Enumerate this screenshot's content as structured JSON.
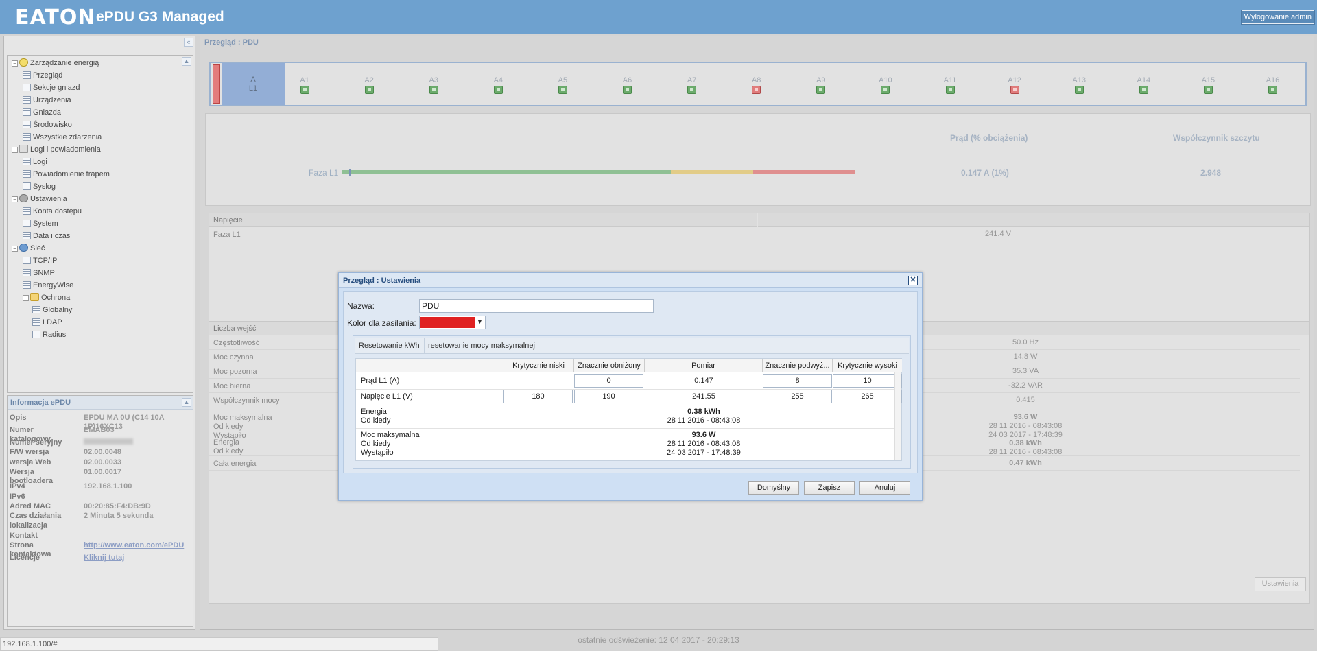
{
  "header": {
    "logo": "EATON",
    "title": "ePDU G3 Managed",
    "logout_label": "Wylogowanie admin"
  },
  "tree": {
    "items": [
      {
        "label": "Zarządzanie energią",
        "level": 0,
        "icon": "bulb-icon"
      },
      {
        "label": "Przegląd",
        "level": 1,
        "icon": "page-icon"
      },
      {
        "label": "Sekcje gniazd",
        "level": 1,
        "icon": "page-icon"
      },
      {
        "label": "Urządzenia",
        "level": 1,
        "icon": "page-icon"
      },
      {
        "label": "Gniazda",
        "level": 1,
        "icon": "page-icon"
      },
      {
        "label": "Środowisko",
        "level": 1,
        "icon": "page-icon"
      },
      {
        "label": "Wszystkie zdarzenia",
        "level": 1,
        "icon": "page-icon"
      },
      {
        "label": "Logi i powiadomienia",
        "level": 0,
        "icon": "log-icon"
      },
      {
        "label": "Logi",
        "level": 1,
        "icon": "page-icon"
      },
      {
        "label": "Powiadomienie trapem",
        "level": 1,
        "icon": "page-icon"
      },
      {
        "label": "Syslog",
        "level": 1,
        "icon": "page-icon"
      },
      {
        "label": "Ustawienia",
        "level": 0,
        "icon": "gear-icon"
      },
      {
        "label": "Konta dostępu",
        "level": 1,
        "icon": "page-icon"
      },
      {
        "label": "System",
        "level": 1,
        "icon": "page-icon"
      },
      {
        "label": "Data i czas",
        "level": 1,
        "icon": "page-icon"
      },
      {
        "label": "Sieć",
        "level": 0,
        "icon": "globe-icon"
      },
      {
        "label": "TCP/IP",
        "level": 1,
        "icon": "page-icon"
      },
      {
        "label": "SNMP",
        "level": 1,
        "icon": "page-icon"
      },
      {
        "label": "EnergyWise",
        "level": 1,
        "icon": "page-icon"
      },
      {
        "label": "Ochrona",
        "level": 1,
        "icon": "folder-icon"
      },
      {
        "label": "Globalny",
        "level": 2,
        "icon": "page-icon"
      },
      {
        "label": "LDAP",
        "level": 2,
        "icon": "page-icon"
      },
      {
        "label": "Radius",
        "level": 2,
        "icon": "page-icon"
      }
    ]
  },
  "info": {
    "title": "Informacja ePDU",
    "rows": [
      {
        "label": "Opis",
        "value": "EPDU MA 0U (C14 10A 1P)16XC13"
      },
      {
        "label": "Numer katalogowy",
        "value": "EMAB03"
      },
      {
        "label": "Numer seryjny",
        "value": ""
      },
      {
        "label": "F/W wersja",
        "value": "02.00.0048"
      },
      {
        "label": "wersja Web",
        "value": "02.00.0033"
      },
      {
        "label": "Wersja bootloadera",
        "value": "01.00.0017"
      },
      {
        "label": "IPv4",
        "value": "192.168.1.100"
      },
      {
        "label": "IPv6",
        "value": ""
      },
      {
        "label": "Adred MAC",
        "value": "00:20:85:F4:DB:9D"
      },
      {
        "label": "Czas działania",
        "value": "2 Minuta 5 sekunda"
      },
      {
        "label": "lokalizacja",
        "value": ""
      },
      {
        "label": "Kontakt",
        "value": ""
      },
      {
        "label": "Strona kontaktowa",
        "value": "http://www.eaton.com/ePDU"
      },
      {
        "label": "Licencje",
        "value": "Kliknij tutaj"
      }
    ]
  },
  "main": {
    "breadcrumb": "Przegląd : PDU",
    "group_a": {
      "name": "A",
      "phase": "L1"
    },
    "outlets": [
      {
        "label": "A1",
        "state": "on"
      },
      {
        "label": "A2",
        "state": "on"
      },
      {
        "label": "A3",
        "state": "on"
      },
      {
        "label": "A4",
        "state": "on"
      },
      {
        "label": "A5",
        "state": "on"
      },
      {
        "label": "A6",
        "state": "on"
      },
      {
        "label": "A7",
        "state": "on"
      },
      {
        "label": "A8",
        "state": "off"
      },
      {
        "label": "A9",
        "state": "on"
      },
      {
        "label": "A10",
        "state": "on"
      },
      {
        "label": "A11",
        "state": "on"
      },
      {
        "label": "A12",
        "state": "off"
      },
      {
        "label": "A13",
        "state": "on"
      },
      {
        "label": "A14",
        "state": "on"
      },
      {
        "label": "A15",
        "state": "on"
      },
      {
        "label": "A16",
        "state": "on"
      }
    ],
    "load": {
      "current_header": "Prąd (% obciążenia)",
      "crest_header": "Współczynnik szczytu",
      "phase_label": "Faza L1",
      "current_value": "0.147 A (1%)",
      "crest_value": "2.948",
      "load_percent": 1
    },
    "voltage": {
      "header": "Napięcie",
      "phase_label": "Faza L1",
      "value": "241.4 V"
    },
    "inputs": {
      "header": "Liczba wejść",
      "rows": [
        {
          "label": "Częstotliwość",
          "value": "50.0 Hz"
        },
        {
          "label": "Moc czynna",
          "value": "14.8 W"
        },
        {
          "label": "Moc pozorna",
          "value": "35.3 VA"
        },
        {
          "label": "Moc bierna",
          "value": "-32.2 VAR"
        },
        {
          "label": "Współczynnik mocy",
          "value": "0.415"
        }
      ],
      "max_power": {
        "l1": "Moc maksymalna",
        "l2": "Od kiedy",
        "l3": "Wystąpiło",
        "v1": "93.6 W",
        "v2": "28 11 2016 - 08:43:08",
        "v3": "24 03 2017 - 17:48:39"
      },
      "energy": {
        "l1": "Energia",
        "l2": "Od kiedy",
        "v1": "0.38 kWh",
        "v2": "28 11 2016 - 08:43:08"
      },
      "total": {
        "l1": "Cała energia",
        "v1": "0.47 kWh"
      }
    },
    "settings_label": "Ustawienia"
  },
  "modal": {
    "title": "Przegląd : Ustawienia",
    "name_label": "Nazwa:",
    "name_value": "PDU",
    "color_label": "Kolor dla zasilania:",
    "color_value": "#e02121",
    "tabs": [
      "Resetowanie kWh",
      "resetowanie mocy maksymalnej"
    ],
    "columns": [
      "Krytycznie niski",
      "Znacznie obniżony",
      "Pomiar",
      "Znacznie podwyż...",
      "Krytycznie wysoki"
    ],
    "current_row": {
      "label": "Prąd L1 (A)",
      "low_crit": "",
      "low_warn": "0",
      "measure": "0.147",
      "high_warn": "8",
      "high_crit": "10"
    },
    "voltage_row": {
      "label": "Napięcie L1 (V)",
      "low_crit": "180",
      "low_warn": "190",
      "measure": "241.55",
      "high_warn": "255",
      "high_crit": "265"
    },
    "energy": {
      "l1": "Energia",
      "l2": "Od kiedy",
      "v1": "0.38 kWh",
      "v2": "28 11 2016 - 08:43:08"
    },
    "max_power": {
      "l1": "Moc maksymalna",
      "l2": "Od kiedy",
      "l3": "Wystąpiło",
      "v1": "93.6 W",
      "v2": "28 11 2016 - 08:43:08",
      "v3": "24 03 2017 - 17:48:39"
    },
    "buttons": {
      "default": "Domyślny",
      "save": "Zapisz",
      "cancel": "Anuluj"
    }
  },
  "status": {
    "last_refresh": "ostatnie odświeżenie: 12 04 2017 - 20:29:13",
    "url": "192.168.1.100/#"
  }
}
